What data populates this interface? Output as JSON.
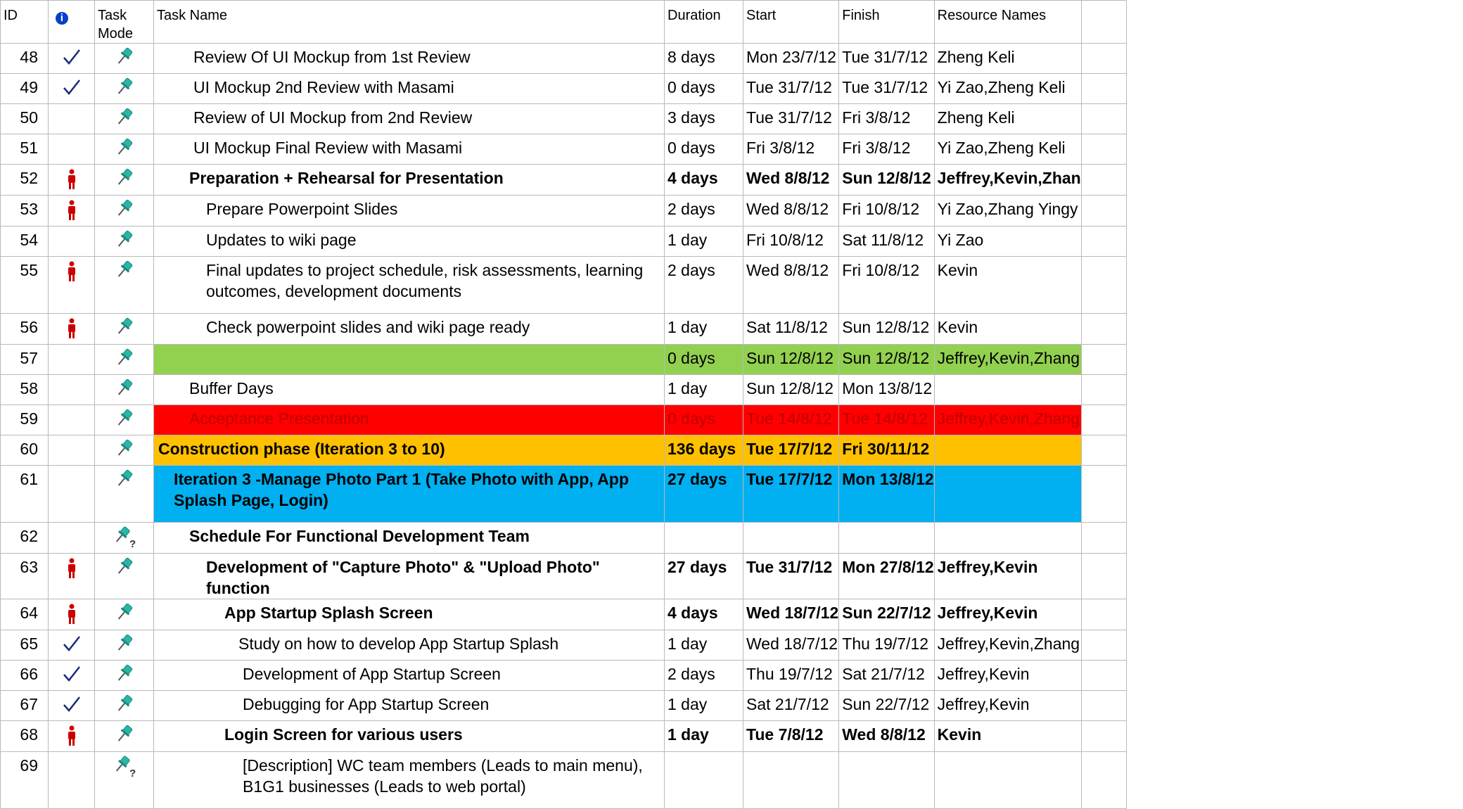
{
  "columns": {
    "id": "ID",
    "task_mode": "Task Mode",
    "task_name": "Task Name",
    "duration": "Duration",
    "start": "Start",
    "finish": "Finish",
    "resources": "Resource Names"
  },
  "rows": [
    {
      "id": "48",
      "indicator": "check",
      "mode": "pin",
      "name": "Review Of UI Mockup from 1st Review",
      "duration": "8 days",
      "start": "Mon 23/7/12",
      "finish": "Tue 31/7/12",
      "resources": "Zheng Keli"
    },
    {
      "id": "49",
      "indicator": "check",
      "mode": "pin",
      "name": "UI Mockup 2nd Review with Masami",
      "duration": "0 days",
      "start": "Tue 31/7/12",
      "finish": "Tue 31/7/12",
      "resources": "Yi Zao,Zheng Keli"
    },
    {
      "id": "50",
      "indicator": "",
      "mode": "pin",
      "name": "Review of UI Mockup from 2nd Review",
      "duration": "3 days",
      "start": "Tue 31/7/12",
      "finish": "Fri 3/8/12",
      "resources": "Zheng Keli"
    },
    {
      "id": "51",
      "indicator": "",
      "mode": "pin",
      "name": "UI Mockup Final Review with Masami",
      "duration": "0 days",
      "start": "Fri 3/8/12",
      "finish": "Fri 3/8/12",
      "resources": "Yi Zao,Zheng Keli"
    },
    {
      "id": "52",
      "indicator": "person",
      "mode": "pin",
      "name": "Preparation + Rehearsal for Presentation",
      "duration": "4 days",
      "start": "Wed 8/8/12",
      "finish": "Sun 12/8/12",
      "resources": "Jeffrey,Kevin,Zhan"
    },
    {
      "id": "53",
      "indicator": "person",
      "mode": "pin",
      "name": "Prepare Powerpoint Slides",
      "duration": "2 days",
      "start": "Wed 8/8/12",
      "finish": "Fri 10/8/12",
      "resources": "Yi Zao,Zhang Yingy"
    },
    {
      "id": "54",
      "indicator": "",
      "mode": "pin",
      "name": "Updates to wiki page",
      "duration": "1 day",
      "start": "Fri 10/8/12",
      "finish": "Sat 11/8/12",
      "resources": "Yi Zao"
    },
    {
      "id": "55",
      "indicator": "person",
      "mode": "pin",
      "name": "Final updates to project schedule, risk assessments, learning outcomes, development documents",
      "duration": "2 days",
      "start": "Wed 8/8/12",
      "finish": "Fri 10/8/12",
      "resources": "Kevin"
    },
    {
      "id": "56",
      "indicator": "person",
      "mode": "pin",
      "name": "Check powerpoint slides and wiki page ready",
      "duration": "1 day",
      "start": "Sat 11/8/12",
      "finish": "Sun 12/8/12",
      "resources": "Kevin"
    },
    {
      "id": "57",
      "indicator": "",
      "mode": "pin",
      "name": "",
      "duration": "0 days",
      "start": "Sun 12/8/12",
      "finish": "Sun 12/8/12",
      "resources": "Jeffrey,Kevin,Zhang"
    },
    {
      "id": "58",
      "indicator": "",
      "mode": "pin",
      "name": "Buffer Days",
      "duration": "1 day",
      "start": "Sun 12/8/12",
      "finish": "Mon 13/8/12",
      "resources": ""
    },
    {
      "id": "59",
      "indicator": "",
      "mode": "pin",
      "name": "Acceptance Presentation",
      "duration": "0 days",
      "start": "Tue 14/8/12",
      "finish": "Tue 14/8/12",
      "resources": "Jeffrey,Kevin,Zhang"
    },
    {
      "id": "60",
      "indicator": "",
      "mode": "pin",
      "name": "Construction phase (Iteration 3 to 10)",
      "duration": "136 days",
      "start": "Tue 17/7/12",
      "finish": "Fri 30/11/12",
      "resources": ""
    },
    {
      "id": "61",
      "indicator": "",
      "mode": "pin",
      "name": "Iteration 3 -Manage Photo Part 1 (Take Photo with App, App Splash Page, Login)",
      "duration": "27 days",
      "start": "Tue 17/7/12",
      "finish": "Mon 13/8/12",
      "resources": ""
    },
    {
      "id": "62",
      "indicator": "",
      "mode": "pin-question",
      "name": "Schedule For Functional Development Team",
      "duration": "",
      "start": "",
      "finish": "",
      "resources": ""
    },
    {
      "id": "63",
      "indicator": "person",
      "mode": "pin",
      "name": "Development of \"Capture Photo\" & \"Upload Photo\" function",
      "duration": "27 days",
      "start": "Tue 31/7/12",
      "finish": "Mon 27/8/12",
      "resources": "Jeffrey,Kevin"
    },
    {
      "id": "64",
      "indicator": "person",
      "mode": "pin",
      "name": "App Startup Splash Screen",
      "duration": "4 days",
      "start": "Wed 18/7/12",
      "finish": "Sun 22/7/12",
      "resources": "Jeffrey,Kevin"
    },
    {
      "id": "65",
      "indicator": "check",
      "mode": "pin",
      "name": "Study on how to develop App Startup Splash",
      "duration": "1 day",
      "start": "Wed 18/7/12",
      "finish": "Thu 19/7/12",
      "resources": "Jeffrey,Kevin,Zhang"
    },
    {
      "id": "66",
      "indicator": "check",
      "mode": "pin",
      "name": "Development of App Startup Screen",
      "duration": "2 days",
      "start": "Thu 19/7/12",
      "finish": "Sat 21/7/12",
      "resources": "Jeffrey,Kevin"
    },
    {
      "id": "67",
      "indicator": "check",
      "mode": "pin",
      "name": "Debugging for App Startup Screen",
      "duration": "1 day",
      "start": "Sat 21/7/12",
      "finish": "Sun 22/7/12",
      "resources": "Jeffrey,Kevin"
    },
    {
      "id": "68",
      "indicator": "person",
      "mode": "pin",
      "name": "Login Screen for various users",
      "duration": "1 day",
      "start": "Tue 7/8/12",
      "finish": "Wed 8/8/12",
      "resources": "Kevin"
    },
    {
      "id": "69",
      "indicator": "",
      "mode": "pin-question",
      "name": "[Description] WC team members (Leads to main menu), B1G1 businesses (Leads to web portal)",
      "duration": "",
      "start": "",
      "finish": "",
      "resources": ""
    }
  ],
  "colors": {
    "green": "#92d050",
    "red": "#ff0000",
    "orange": "#ffc000",
    "blue": "#00b0f0",
    "pin": "#2bb5a6",
    "person": "#cc0000",
    "check": "#1a2a7a",
    "info": "#0a3fc8"
  }
}
